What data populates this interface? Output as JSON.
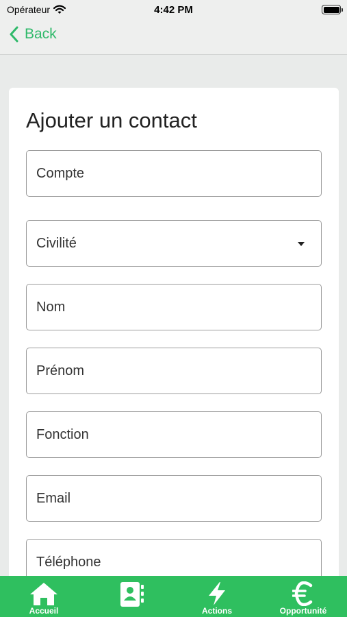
{
  "status": {
    "carrier": "Opérateur",
    "time": "4:42 PM"
  },
  "nav": {
    "back_label": "Back"
  },
  "form": {
    "title": "Ajouter un contact",
    "fields": {
      "compte": "Compte",
      "civilite": "Civilité",
      "nom": "Nom",
      "prenom": "Prénom",
      "fonction": "Fonction",
      "email": "Email",
      "telephone": "Téléphone"
    }
  },
  "tabs": {
    "accueil": "Accueil",
    "contacts": "",
    "actions": "Actions",
    "opportunite": "Opportunité"
  },
  "colors": {
    "accent": "#2fb96a",
    "tab_bar": "#2fbf5f"
  },
  "icons": [
    "wifi-icon",
    "battery-icon",
    "chevron-left-icon",
    "caret-down-icon",
    "home-icon",
    "contacts-icon",
    "bolt-icon",
    "euro-icon"
  ]
}
